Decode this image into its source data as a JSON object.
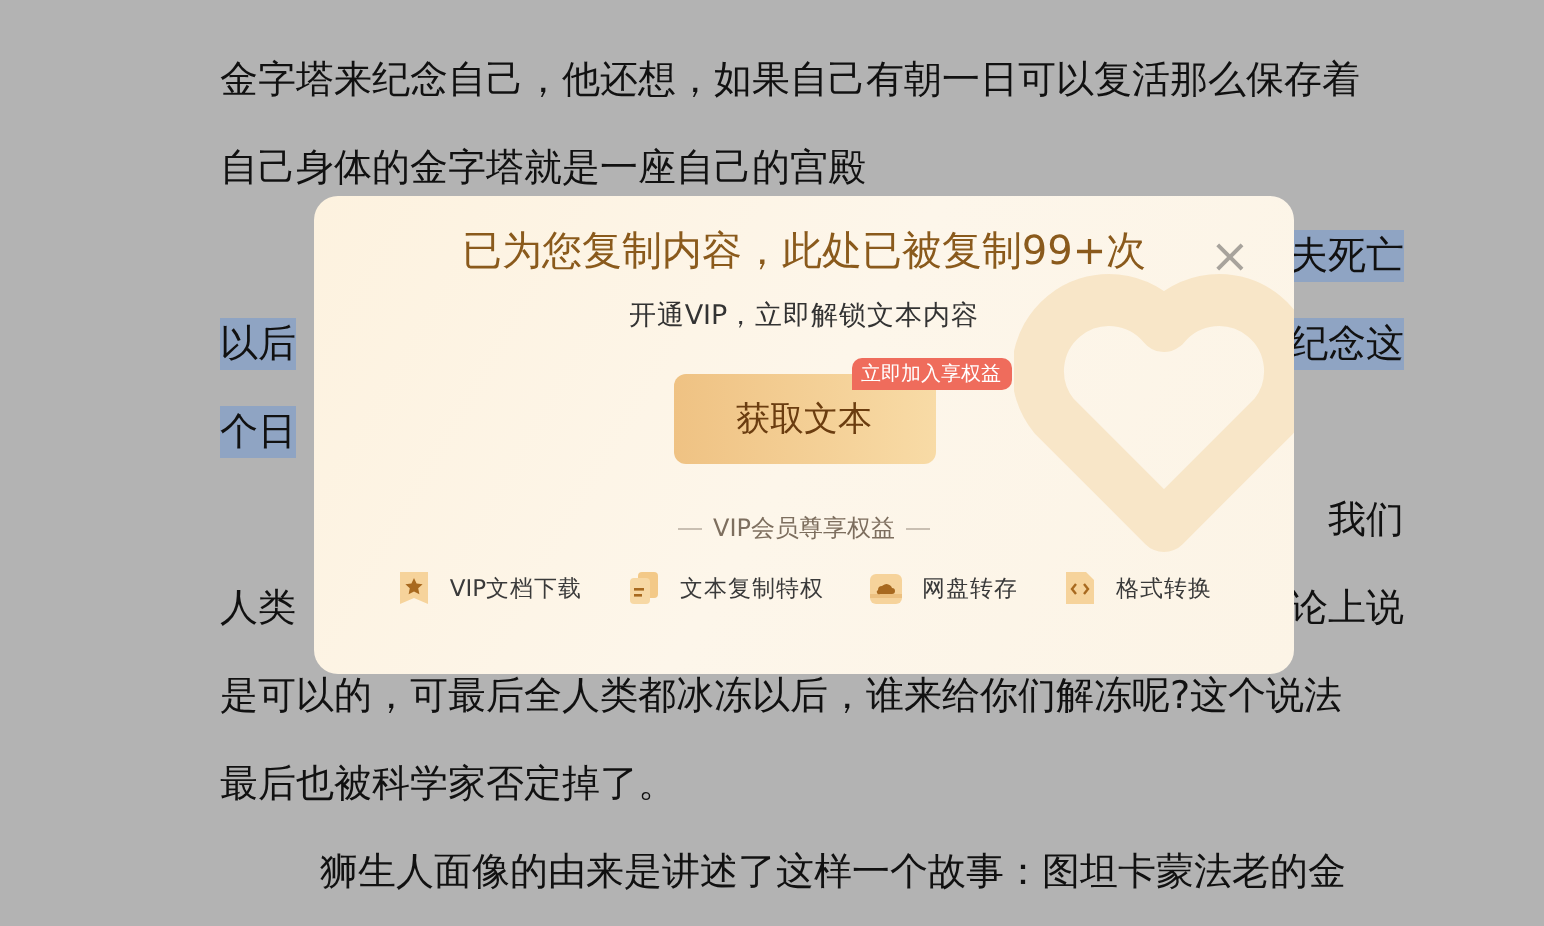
{
  "document": {
    "lines": [
      {
        "indented": false,
        "left": {
          "text": "金字塔来纪念自己，他还想，如果自己有朝一日可以复活那么保存着",
          "highlighted": false
        }
      },
      {
        "indented": false,
        "left": {
          "text": "自己身体的金字塔就是一座自己的宫殿",
          "highlighted": false
        }
      },
      {
        "right": {
          "text": "夫死亡",
          "highlighted": true
        }
      },
      {
        "indented": false,
        "left": {
          "text": "以后",
          "highlighted": true
        },
        "right": {
          "text": "纪念这",
          "highlighted": true
        }
      },
      {
        "indented": false,
        "left": {
          "text": "个日",
          "highlighted": true
        }
      },
      {
        "right": {
          "text": "我们",
          "highlighted": false
        }
      },
      {
        "indented": false,
        "left": {
          "text": "人类",
          "highlighted": false
        },
        "right": {
          "text": "论上说",
          "highlighted": false
        }
      },
      {
        "indented": false,
        "left": {
          "text": "是可以的，可最后全人类都冰冻以后，谁来给你们解冻呢?这个说法",
          "highlighted": false
        }
      },
      {
        "indented": false,
        "left": {
          "text": "最后也被科学家否定掉了。",
          "highlighted": false
        }
      },
      {
        "indented": true,
        "left": {
          "text": "狮生人面像的由来是讲述了这样一个故事：图坦卡蒙法老的金",
          "highlighted": false
        }
      }
    ]
  },
  "dialog": {
    "close": "×",
    "title": "已为您复制内容，此处已被复制99+次",
    "subtitle": "开通VIP，立即解锁文本内容",
    "button": "获取文本",
    "badge": "立即加入享权益",
    "benefits_heading": "VIP会员尊享权益",
    "benefits": [
      {
        "kind": "download",
        "label": "VIP文档下载"
      },
      {
        "kind": "copy",
        "label": "文本复制特权"
      },
      {
        "kind": "disk",
        "label": "网盘转存"
      },
      {
        "kind": "convert",
        "label": "格式转换"
      }
    ]
  }
}
